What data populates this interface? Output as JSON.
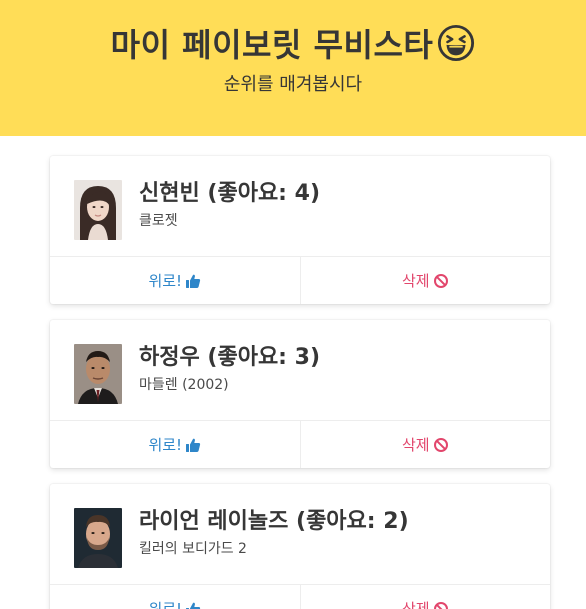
{
  "hero": {
    "title": "마이 페이보릿 무비스타",
    "subtitle": "순위를 매겨봅시다",
    "emoji_icon": "laughing-squint-face-icon"
  },
  "labels": {
    "likes_prefix": "(좋아요: ",
    "likes_suffix": ")",
    "up_label": "위로!",
    "delete_label": "삭제"
  },
  "colors": {
    "hero_bg": "#ffdd57",
    "up": "#2e86c9",
    "delete": "#e2466c"
  },
  "stars": [
    {
      "name": "신현빈",
      "likes": "4",
      "movie": "클로젯"
    },
    {
      "name": "하정우",
      "likes": "3",
      "movie": "마들렌 (2002)"
    },
    {
      "name": "라이언 레이놀즈",
      "likes": "2",
      "movie": "킬러의 보디가드 2"
    }
  ]
}
